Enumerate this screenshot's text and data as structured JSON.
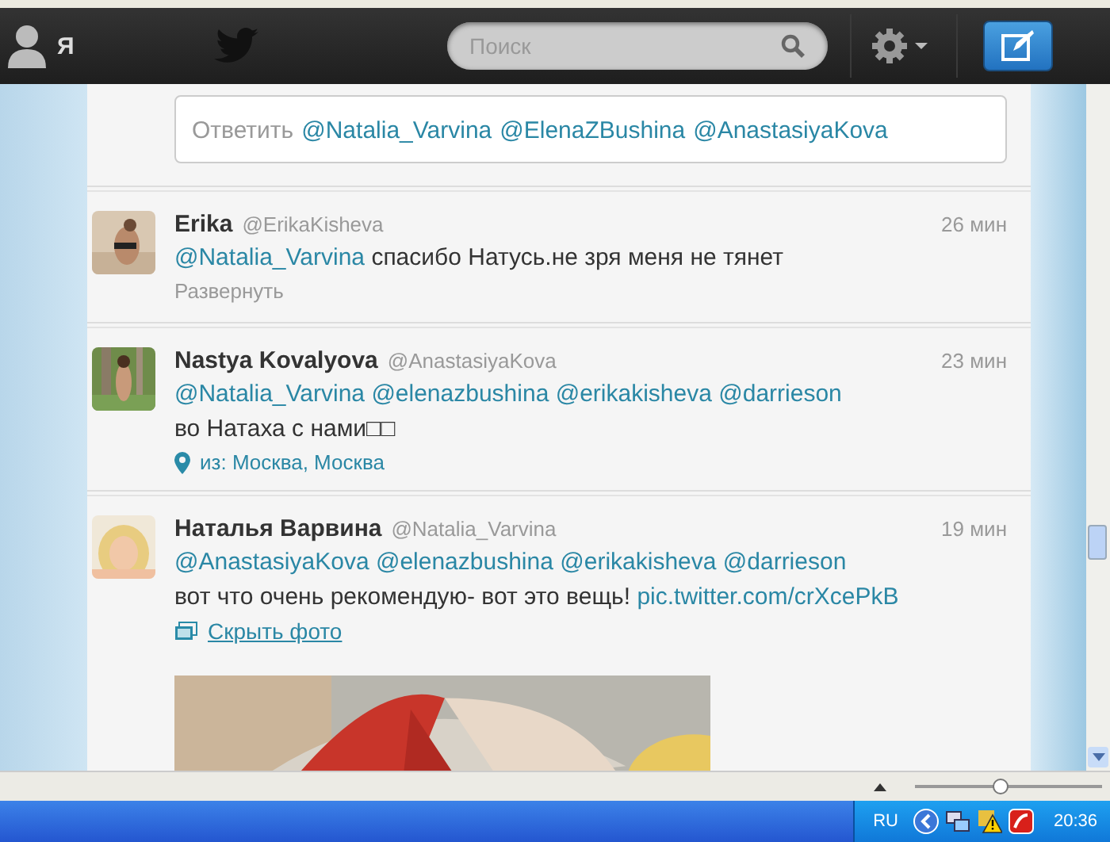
{
  "topbar": {
    "me_label": "Я",
    "search": {
      "placeholder": "Поиск"
    }
  },
  "reply_box": {
    "prompt": "Ответить",
    "mentions": [
      "@Natalia_Varvina",
      "@ElenaZBushina",
      "@AnastasiyaKova"
    ]
  },
  "tweets": [
    {
      "name": "Erika",
      "handle": "@ErikaKisheva",
      "time": "26 мин",
      "lines": [
        [
          {
            "kind": "mention",
            "text": "@Natalia_Varvina"
          },
          {
            "kind": "text",
            "text": "спасибо Натусь.не зря меня не тянет"
          }
        ]
      ],
      "action": {
        "kind": "expand",
        "label": "Развернуть"
      }
    },
    {
      "name": "Nastya Kovalyova",
      "handle": "@AnastasiyaKova",
      "time": "23 мин",
      "lines": [
        [
          {
            "kind": "mention",
            "text": "@Natalia_Varvina"
          },
          {
            "kind": "mention",
            "text": "@elenazbushina"
          },
          {
            "kind": "mention",
            "text": "@erikakisheva"
          },
          {
            "kind": "mention",
            "text": "@darrieson"
          }
        ],
        [
          {
            "kind": "text",
            "text": "во Натаха с нами□□"
          }
        ]
      ],
      "location": "из: Москва, Москва"
    },
    {
      "name": "Наталья Варвина",
      "handle": "@Natalia_Varvina",
      "time": "19 мин",
      "lines": [
        [
          {
            "kind": "mention",
            "text": "@AnastasiyaKova"
          },
          {
            "kind": "mention",
            "text": "@elenazbushina"
          },
          {
            "kind": "mention",
            "text": "@erikakisheva"
          },
          {
            "kind": "mention",
            "text": "@darrieson"
          }
        ],
        [
          {
            "kind": "text",
            "text": "вот что очень рекомендую- вот это вещь!"
          },
          {
            "kind": "link",
            "text": "pic.twitter.com/crXcePkB"
          }
        ]
      ],
      "action": {
        "kind": "hide_photo",
        "label": "Скрыть фото"
      },
      "media": {
        "kind": "picture"
      }
    }
  ],
  "status_bar": {
    "zoom": {
      "level": 0.46
    }
  },
  "taskbar": {
    "language": "RU",
    "clock": "20:36"
  }
}
